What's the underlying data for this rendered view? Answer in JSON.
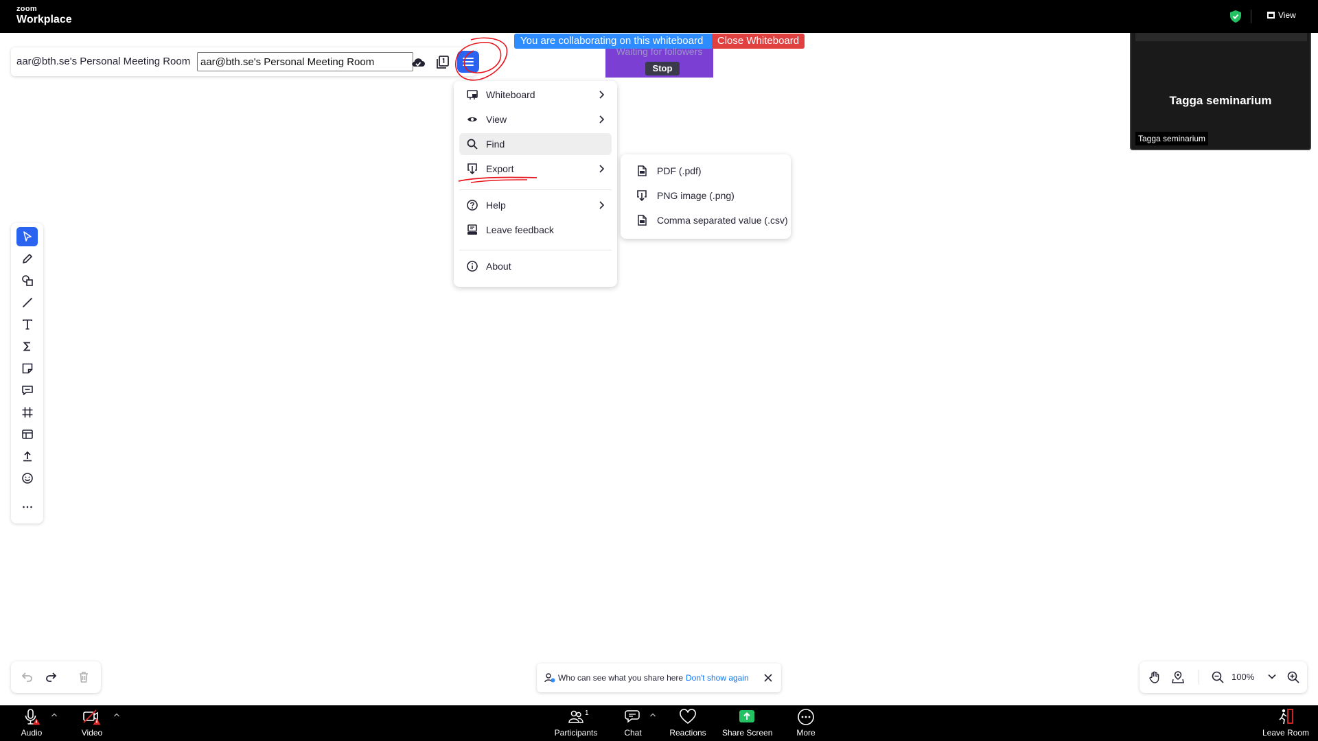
{
  "app": {
    "brand_top": "zoom",
    "brand_name": "Workplace",
    "view_label": "View"
  },
  "header": {
    "room_title": "aar@bth.se's Personal Meeting Room",
    "room_input_value": "aar@bth.se's Personal Meeting Room"
  },
  "banners": {
    "collaborating": "You are collaborating on this whiteboard",
    "close_whiteboard": "Close Whiteboard",
    "waiting": "Waiting for followers",
    "stop": "Stop"
  },
  "menu": {
    "items": [
      {
        "label": "Whiteboard",
        "icon": "whiteboard-icon",
        "submenu": true
      },
      {
        "label": "View",
        "icon": "eye-icon",
        "submenu": true
      },
      {
        "label": "Find",
        "icon": "search-icon",
        "submenu": false,
        "highlighted": true
      },
      {
        "label": "Export",
        "icon": "export-icon",
        "submenu": true
      },
      {
        "label": "Help",
        "icon": "help-icon",
        "submenu": true
      },
      {
        "label": "Leave feedback",
        "icon": "feedback-icon",
        "submenu": false
      },
      {
        "label": "About",
        "icon": "info-icon",
        "submenu": false
      }
    ]
  },
  "export_submenu": {
    "items": [
      {
        "label": "PDF (.pdf)",
        "icon": "file-icon"
      },
      {
        "label": "PNG image (.png)",
        "icon": "export-icon"
      },
      {
        "label": "Comma separated value (.csv)",
        "icon": "file-icon"
      }
    ]
  },
  "video": {
    "name_large": "Tagga seminarium",
    "name_tag": "Tagga seminarium"
  },
  "toolbar": {
    "tools": [
      "select",
      "pen",
      "shapes",
      "line",
      "text",
      "formula",
      "sticky-note",
      "comment",
      "frame",
      "template",
      "upload",
      "emoji",
      "more"
    ]
  },
  "toast": {
    "text": "Who can see what you share here",
    "link": "Don't show again"
  },
  "zoom": {
    "level": "100%"
  },
  "controls": {
    "audio": "Audio",
    "video": "Video",
    "participants": "Participants",
    "participants_count": "1",
    "chat": "Chat",
    "reactions": "Reactions",
    "share_screen": "Share Screen",
    "more": "More",
    "leave_room": "Leave Room"
  },
  "colors": {
    "accent": "#2a63f0",
    "banner_blue": "#2d8cff",
    "close_red": "#e0403f",
    "followers_purple": "#7b3fd4",
    "share_green": "#24c164",
    "warning_red": "#e02828"
  }
}
